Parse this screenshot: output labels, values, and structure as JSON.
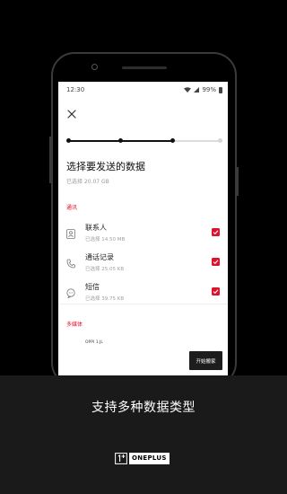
{
  "colors": {
    "accent": "#e0112b",
    "background": "#000000",
    "bottom_bar": "#1a1a1a",
    "button": "#1d1d1d"
  },
  "status_bar": {
    "time": "12:30",
    "battery": "99%"
  },
  "header": {
    "close_icon": "close-icon"
  },
  "progress": {
    "steps_total": 4,
    "current_step": 3
  },
  "page": {
    "title": "选择要发送的数据",
    "subtitle": "已选择 20.07 GB"
  },
  "sections": {
    "communication": "通讯",
    "media": "多媒体"
  },
  "items": [
    {
      "label": "联系人",
      "size": "已选择 14.50 MB",
      "icon": "contacts-icon",
      "checked": true
    },
    {
      "label": "通话记录",
      "size": "已选择 25.05 KB",
      "icon": "phone-icon",
      "checked": true
    },
    {
      "label": "短信",
      "size": "已选择 39.75 KB",
      "icon": "message-icon",
      "checked": true
    }
  ],
  "media_partial_text": "OPPI 1.JL",
  "start_button": "开始搬家",
  "caption": "支持多种数据类型",
  "brand": {
    "logo_text": "ONEPLUS"
  }
}
